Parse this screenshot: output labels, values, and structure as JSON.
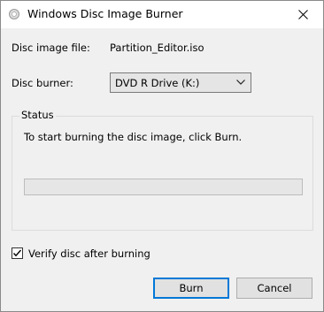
{
  "window": {
    "title": "Windows Disc Image Burner"
  },
  "icons": {
    "app": "disc-icon",
    "close": "close-icon",
    "dropdown": "chevron-down-icon",
    "check": "checkmark-icon"
  },
  "form": {
    "image_file_label": "Disc image file:",
    "image_file_value": "Partition_Editor.iso",
    "burner_label": "Disc burner:",
    "burner_value": "DVD R Drive (K:)"
  },
  "status": {
    "legend": "Status",
    "message": "To start burning the disc image, click Burn.",
    "progress": 0
  },
  "options": {
    "verify_label": "Verify disc after burning",
    "verify_checked": true
  },
  "buttons": {
    "burn": "Burn",
    "cancel": "Cancel"
  },
  "colors": {
    "accent": "#0078d7",
    "window_bg": "#f0f0f0"
  }
}
